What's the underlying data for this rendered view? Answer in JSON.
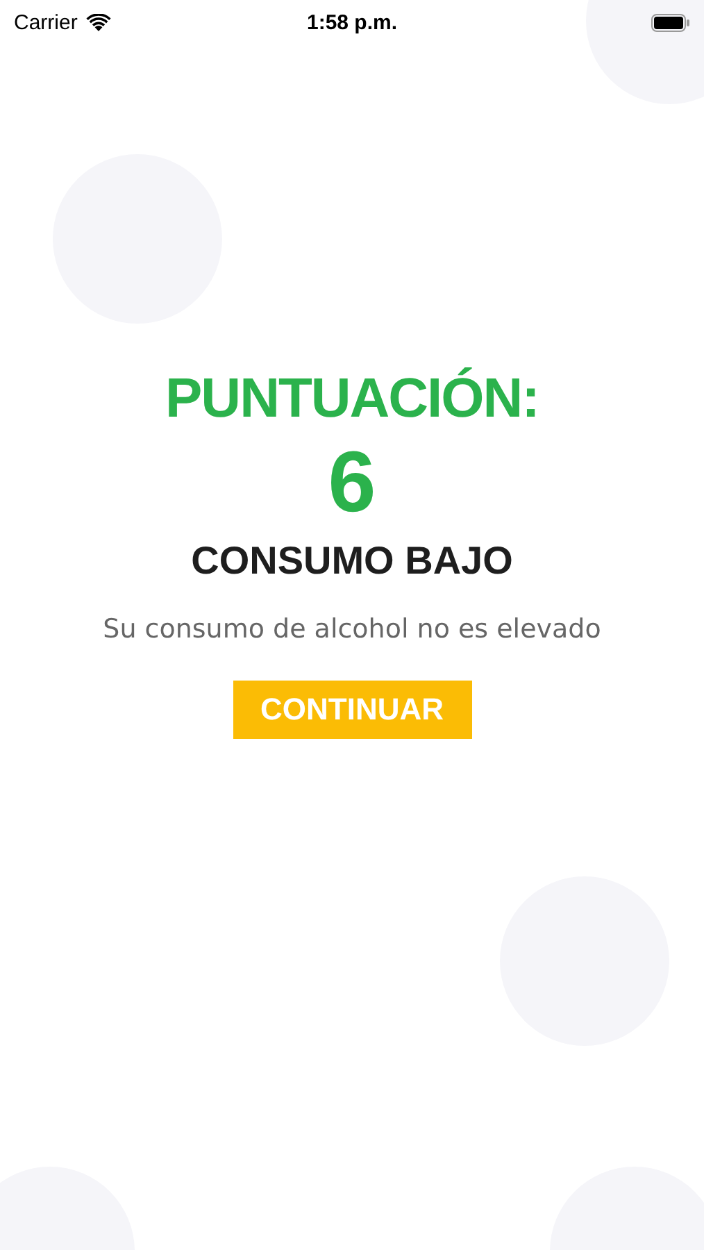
{
  "status_bar": {
    "carrier": "Carrier",
    "time": "1:58 p.m."
  },
  "result": {
    "label": "PUNTUACIÓN:",
    "score": "6",
    "level": "CONSUMO BAJO",
    "message": "Su consumo de alcohol no es elevado"
  },
  "button": "CONTINUAR"
}
